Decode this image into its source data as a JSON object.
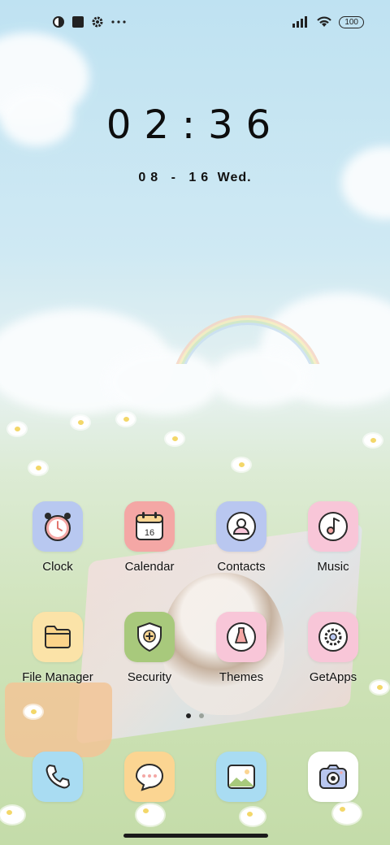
{
  "status_bar": {
    "battery": "100",
    "icons": [
      "circle-half-icon",
      "square-app-icon",
      "settings-gear-icon",
      "more-dots-icon",
      "signal-icon",
      "wifi-icon"
    ]
  },
  "clock": {
    "time": "02:36",
    "date_digits": "08 - 16",
    "weekday": "Wed."
  },
  "apps": [
    {
      "label": "Clock",
      "icon": "alarm-clock-icon",
      "color": "#b8c8f0"
    },
    {
      "label": "Calendar",
      "icon": "calendar-icon",
      "color": "#f4a7a5",
      "day": "16"
    },
    {
      "label": "Contacts",
      "icon": "person-icon",
      "color": "#b9c7f0"
    },
    {
      "label": "Music",
      "icon": "music-note-icon",
      "color": "#f8c6d8"
    },
    {
      "label": "File Manager",
      "icon": "folder-icon",
      "color": "#fbe3a8"
    },
    {
      "label": "Security",
      "icon": "shield-icon",
      "color": "#a8c97c"
    },
    {
      "label": "Themes",
      "icon": "dress-icon",
      "color": "#f8c6d8"
    },
    {
      "label": "GetApps",
      "icon": "gear-planet-icon",
      "color": "#f8c6d8"
    }
  ],
  "page_indicator": {
    "count": 2,
    "active": 0
  },
  "dock": [
    {
      "icon": "phone-icon",
      "color": "#a9dcf2"
    },
    {
      "icon": "chat-bubble-icon",
      "color": "#fbd592"
    },
    {
      "icon": "gallery-icon",
      "color": "#a9dcf2"
    },
    {
      "icon": "camera-icon",
      "color": "#ffffff"
    }
  ]
}
